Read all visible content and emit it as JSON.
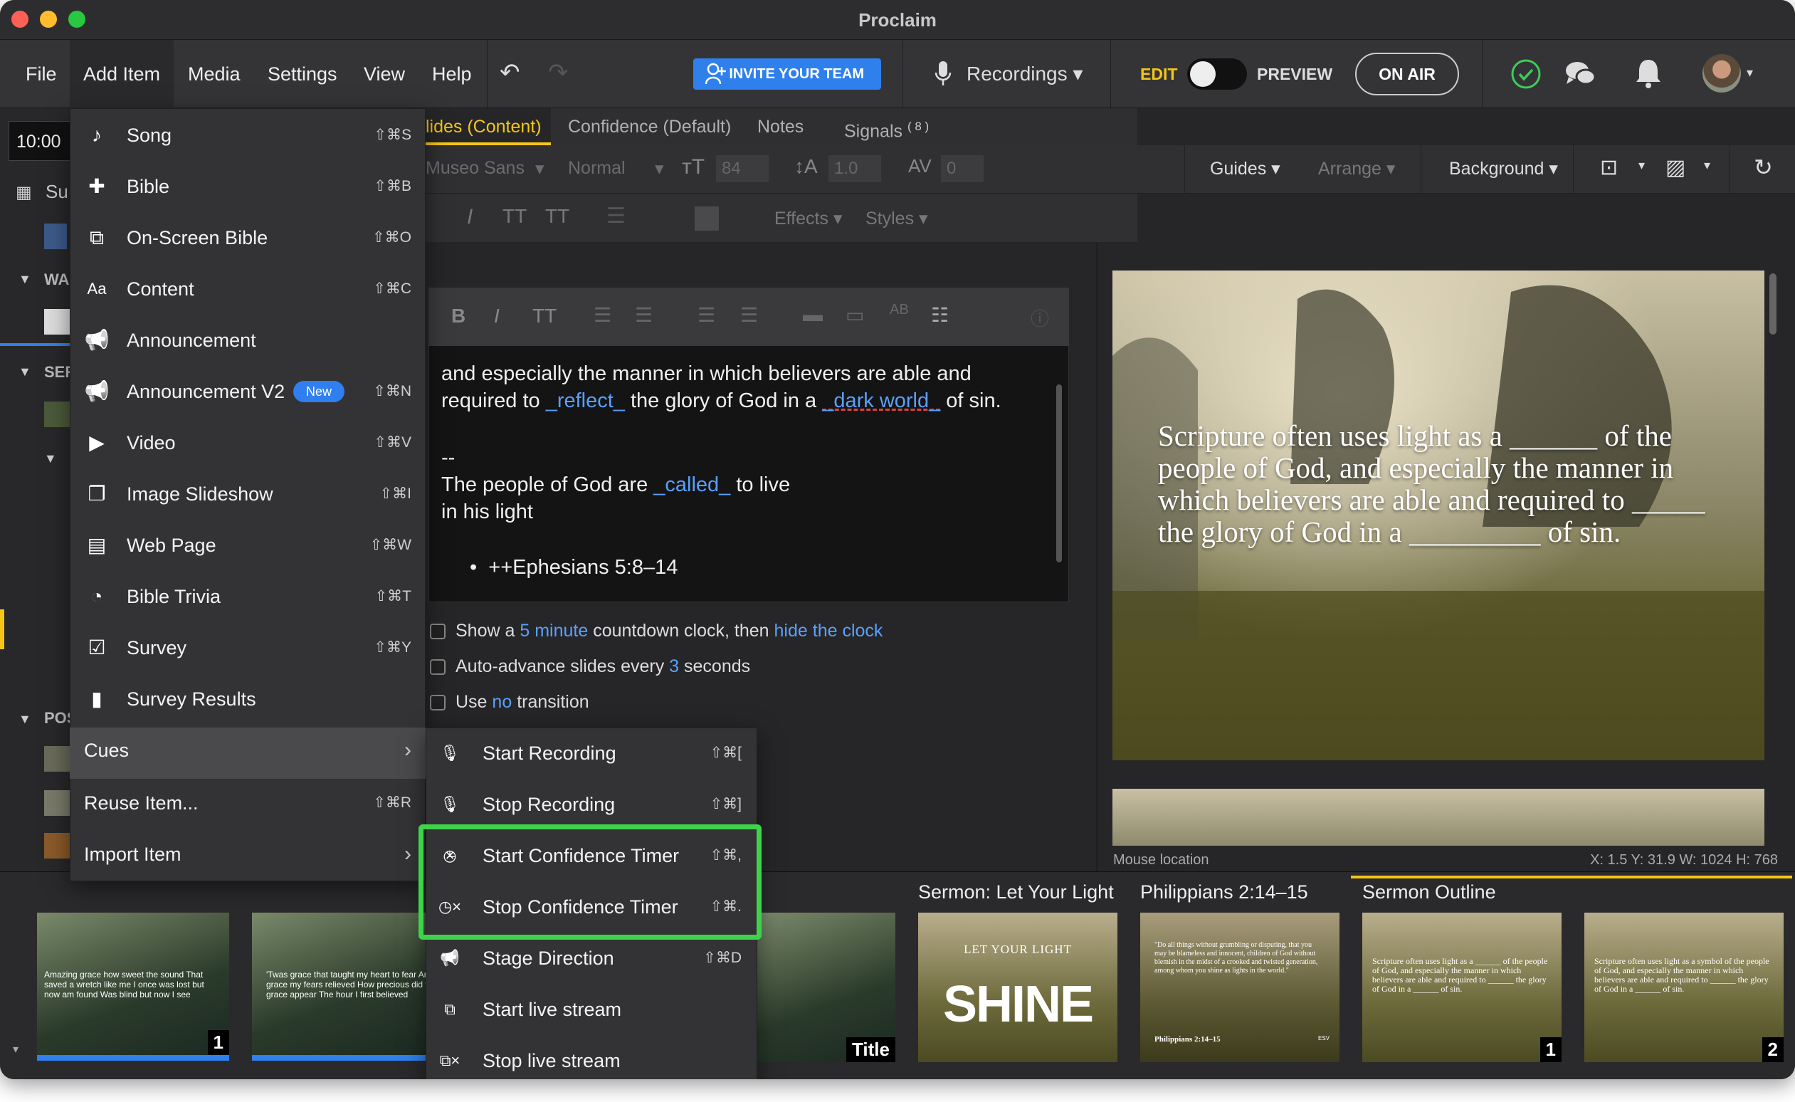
{
  "app": {
    "title": "Proclaim"
  },
  "menubar": {
    "items": [
      "File",
      "Add Item",
      "Media",
      "Settings",
      "View",
      "Help"
    ],
    "invite": "INVITE YOUR TEAM",
    "recordings": "Recordings",
    "edit": "EDIT",
    "preview": "PREVIEW",
    "on_air": "ON AIR"
  },
  "left": {
    "time": "10:00",
    "sunday": "Su",
    "wa": "WA",
    "ser": "SER",
    "pos": "POS"
  },
  "tabs": [
    "lides (Content)",
    "Confidence (Default)",
    "Notes",
    "Signals"
  ],
  "signals_count": "( 8 )",
  "toolbar": {
    "font": "Museo Sans",
    "weight": "Normal",
    "size": "84",
    "line": "1.0",
    "spacing": "0",
    "guides": "Guides",
    "arrange": "Arrange",
    "background": "Background",
    "effects": "Effects",
    "styles": "Styles"
  },
  "editor": {
    "line1": "and especially the manner in which believers are able and",
    "line2a": "required to ",
    "line2b": "_reflect_",
    "line2c": " the glory of God in a ",
    "line2d": "_dark world_",
    "line2e": " of sin.",
    "line3": "--",
    "line4a": "The people of God are ",
    "line4b": "_called_",
    "line4c": " to live",
    "line5": "in his light",
    "bullet": "++Ephesians 5:8–14"
  },
  "options": {
    "show_a": "Show a",
    "five_minute": "5 minute",
    "countdown": "countdown clock, then",
    "hide_clock": "hide the clock",
    "auto_adv": "Auto-advance slides every",
    "three": "3",
    "seconds": "seconds",
    "use": "Use",
    "no": "no",
    "transition": "transition"
  },
  "slide_preview": {
    "text": "Scripture often uses light as a ______ of the people of God, and especially the manner in which believers are able and required to _____ the glory of God in a _________ of sin."
  },
  "status": {
    "mouse": "Mouse location",
    "coords": "X: 1.5  Y: 31.9    W: 1024  H: 768"
  },
  "strip": {
    "titles": [
      "Sermon: Let Your Light",
      "Philippians 2:14–15",
      "Sermon Outline"
    ],
    "thumb1_text": "Amazing grace how sweet the sound That saved a wretch like me I once was lost but now am found Was blind but now I see",
    "thumb2_text": "'Twas grace that taught my heart to fear And grace my fears relieved How precious did that grace appear The hour I first believed",
    "num1": "1",
    "title_label": "Title",
    "num_outline1": "1",
    "num_outline2": "2",
    "shine_top": "LET YOUR LIGHT",
    "shine": "SHINE",
    "phil_text": "\"Do all things without grumbling or disputing, that you may be blameless and innocent, children of God without blemish in the midst of a crooked and twisted generation, among whom you shine as lights in the world.\"",
    "phil_ref": "Philippians 2:14–15",
    "phil_esv": "ESV",
    "outline_text": "Scripture often uses light as a ______ of the people of God, and especially the manner in which believers are able and required to ______ the glory of God in a ______ of sin.",
    "outline2_text": "Scripture often uses light as a symbol of the people of God, and especially the manner in which believers are able and required to ______ the glory of God in a ______ of sin."
  },
  "add_menu": {
    "items": [
      {
        "label": "Song",
        "shortcut": "⇧⌘S",
        "icon": "music-note-icon"
      },
      {
        "label": "Bible",
        "shortcut": "⇧⌘B",
        "icon": "bible-icon"
      },
      {
        "label": "On-Screen Bible",
        "shortcut": "⇧⌘O",
        "icon": "onscreen-bible-icon"
      },
      {
        "label": "Content",
        "shortcut": "⇧⌘C",
        "icon": "text-aa-icon"
      },
      {
        "label": "Announcement",
        "shortcut": "",
        "icon": "megaphone-icon"
      },
      {
        "label": "Announcement V2",
        "shortcut": "⇧⌘N",
        "icon": "megaphone-icon",
        "badge": "New"
      },
      {
        "label": "Video",
        "shortcut": "⇧⌘V",
        "icon": "video-camera-icon"
      },
      {
        "label": "Image Slideshow",
        "shortcut": "⇧⌘I",
        "icon": "slideshow-icon"
      },
      {
        "label": "Web Page",
        "shortcut": "⇧⌘W",
        "icon": "web-page-icon"
      },
      {
        "label": "Bible Trivia",
        "shortcut": "⇧⌘T",
        "icon": "pie-chart-icon"
      },
      {
        "label": "Survey",
        "shortcut": "⇧⌘Y",
        "icon": "survey-check-icon"
      },
      {
        "label": "Survey Results",
        "shortcut": "",
        "icon": "bar-chart-icon"
      }
    ],
    "cues": "Cues",
    "reuse": "Reuse Item...",
    "reuse_shortcut": "⇧⌘R",
    "import": "Import Item"
  },
  "cues_menu": {
    "items": [
      {
        "label": "Start Recording",
        "shortcut": "⇧⌘[",
        "icon": "microphone-icon"
      },
      {
        "label": "Stop Recording",
        "shortcut": "⇧⌘]",
        "icon": "microphone-stop-icon"
      },
      {
        "label": "Start Confidence Timer",
        "shortcut": "⇧⌘,",
        "icon": "clock-icon"
      },
      {
        "label": "Stop Confidence Timer",
        "shortcut": "⇧⌘.",
        "icon": "clock-stop-icon"
      },
      {
        "label": "Stage Direction",
        "shortcut": "⇧⌘D",
        "icon": "megaphone-icon"
      },
      {
        "label": "Start live stream",
        "shortcut": "",
        "icon": "live-stream-icon"
      },
      {
        "label": "Stop live stream",
        "shortcut": "",
        "icon": "live-stream-stop-icon"
      }
    ]
  }
}
